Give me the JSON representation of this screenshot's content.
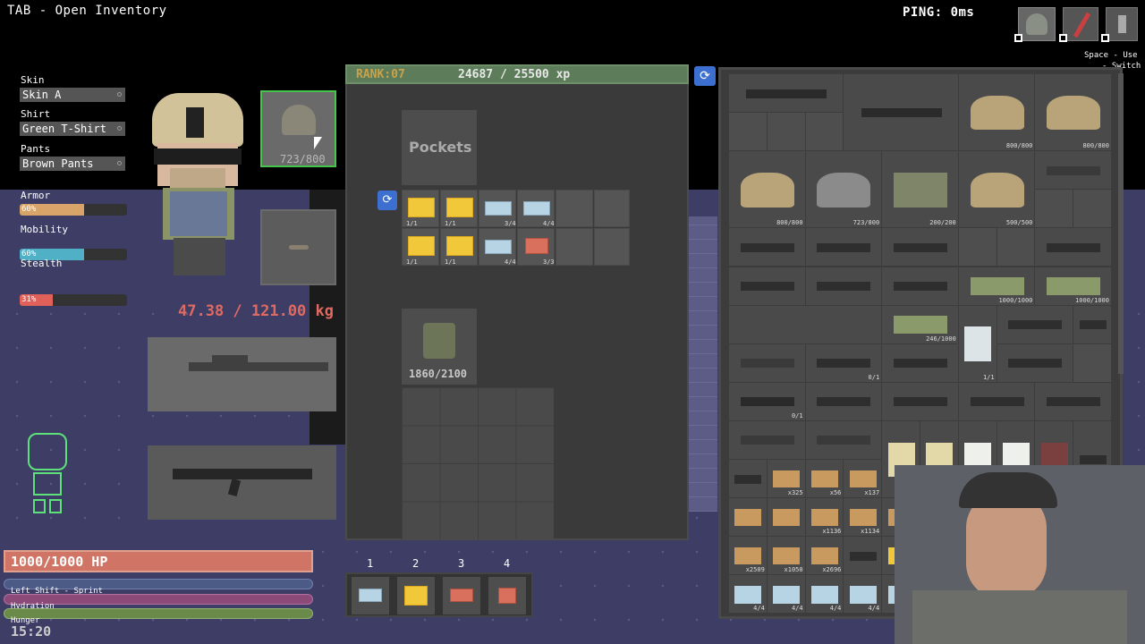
{
  "hud": {
    "open_inventory_hint": "TAB - Open Inventory",
    "ping": "PING: 0ms",
    "space_hint": "Space - Use",
    "switch_hint": "- Switch",
    "clock": "15:20"
  },
  "character": {
    "skin_label": "Skin",
    "skin_value": "Skin A",
    "shirt_label": "Shirt",
    "shirt_value": "Green T-Shirt",
    "pants_label": "Pants",
    "pants_value": "Brown Pants",
    "helmet_durability": "723/800",
    "weight": "47.38 / 121.00 kg"
  },
  "stats": {
    "armor_label": "Armor",
    "armor_value": "60%",
    "armor_level": 0.6,
    "mobility_label": "Mobility",
    "mobility_value": "60%",
    "mobility_level": 0.6,
    "stealth_label": "Stealth",
    "stealth_value": "31%",
    "stealth_level": 0.31,
    "armor_color": "#d9a46a",
    "mobility_color": "#4fb0c6",
    "stealth_color": "#e0605a"
  },
  "rank": {
    "rank_label": "RANK:07",
    "xp_text": "24687 / 25500 xp"
  },
  "pockets": {
    "title": "Pockets",
    "counts": [
      "1/1",
      "1/1",
      "3/4",
      "4/4",
      "1/1",
      "1/1",
      "4/4",
      "3/3"
    ],
    "rig_durability": "1860/2100"
  },
  "vitals": {
    "hp": "1000/1000 HP",
    "sprint_label": "Left Shift - Sprint",
    "hydration_label": "Hydration",
    "hunger_label": "Hunger"
  },
  "hotbar": {
    "keys": [
      "1",
      "2",
      "3",
      "4"
    ]
  },
  "stash": {
    "labels": [
      "1/1",
      "800/800",
      "800/800",
      "800/800",
      "723/800",
      "200/200",
      "500/500",
      "1000/1000",
      "1000/1000",
      "246/1000",
      "0/1",
      "1/1",
      "0/1",
      "x325",
      "x56",
      "x137",
      "x1136",
      "x1134",
      "x157",
      "x387",
      "x1043",
      "x2509",
      "x1050",
      "x2696",
      "4/4",
      "4/4",
      "4/4",
      "4/4"
    ]
  }
}
